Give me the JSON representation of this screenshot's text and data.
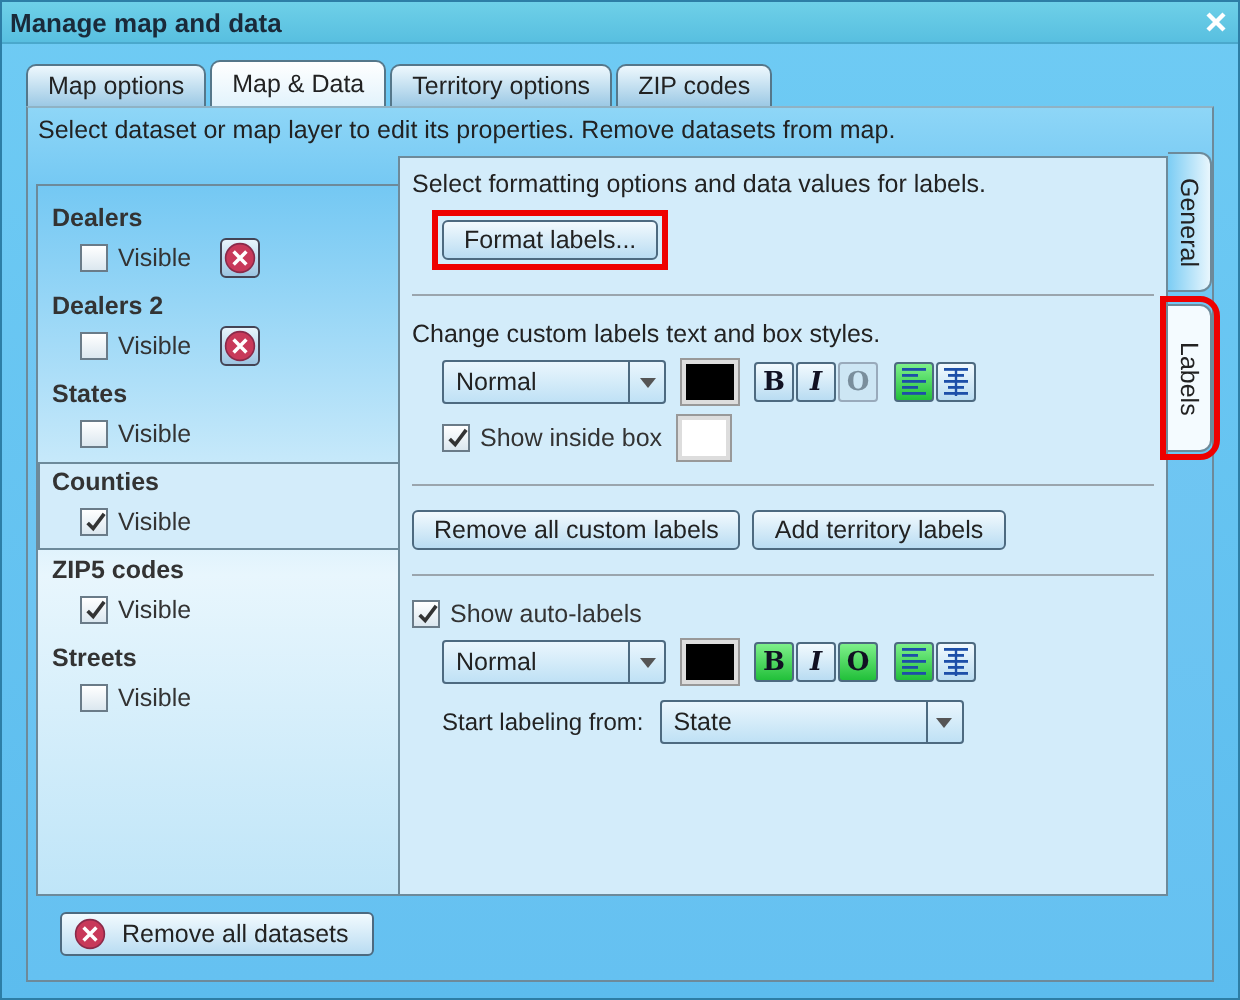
{
  "window": {
    "title": "Manage map and data"
  },
  "tabs": [
    {
      "label": "Map options",
      "selected": false
    },
    {
      "label": "Map & Data",
      "selected": true
    },
    {
      "label": "Territory options",
      "selected": false
    },
    {
      "label": "ZIP codes",
      "selected": false
    }
  ],
  "instructions": "Select dataset or map layer to edit its properties. Remove datasets from map.",
  "layers": [
    {
      "name": "Dealers",
      "checkbox": "Visible",
      "visible": false,
      "removable": true,
      "selected": false
    },
    {
      "name": "Dealers 2",
      "checkbox": "Visible",
      "visible": false,
      "removable": true,
      "selected": false
    },
    {
      "name": "States",
      "checkbox": "Visible",
      "visible": false,
      "removable": false,
      "selected": false
    },
    {
      "name": "Counties",
      "checkbox": "Visible",
      "visible": true,
      "removable": false,
      "selected": true
    },
    {
      "name": "ZIP5 codes",
      "checkbox": "Visible",
      "visible": true,
      "removable": false,
      "selected": false
    },
    {
      "name": "Streets",
      "checkbox": "Visible",
      "visible": false,
      "removable": false,
      "selected": false
    }
  ],
  "side_tabs": [
    {
      "label": "General",
      "selected": false,
      "highlighted": false
    },
    {
      "label": "Labels",
      "selected": true,
      "highlighted": true
    }
  ],
  "format_section": {
    "text": "Select formatting options and data values for labels.",
    "button": "Format labels...",
    "highlighted": true
  },
  "custom_section": {
    "text": "Change custom labels text and box styles.",
    "style": "Normal",
    "color": "#000000",
    "toggles": [
      {
        "label": "B",
        "kind": "bold",
        "on": false,
        "disabled": false
      },
      {
        "label": "I",
        "kind": "italic",
        "on": false,
        "disabled": false
      },
      {
        "label": "O",
        "kind": "outline",
        "on": false,
        "disabled": true
      }
    ],
    "align": [
      {
        "kind": "left",
        "on": true
      },
      {
        "kind": "center",
        "on": false
      }
    ],
    "box": {
      "label": "Show inside box",
      "checked": true,
      "color": "#ffffff"
    }
  },
  "label_buttons": [
    "Remove all custom labels",
    "Add territory labels"
  ],
  "auto_section": {
    "label": "Show auto-labels",
    "checked": true,
    "style": "Normal",
    "color": "#000000",
    "toggles": [
      {
        "label": "B",
        "kind": "bold",
        "on": true,
        "disabled": false
      },
      {
        "label": "I",
        "kind": "italic",
        "on": false,
        "disabled": false
      },
      {
        "label": "O",
        "kind": "outline",
        "on": true,
        "disabled": false
      }
    ],
    "align": [
      {
        "kind": "left",
        "on": true
      },
      {
        "kind": "center",
        "on": false
      }
    ],
    "start_label": "Start labeling from:",
    "start_value": "State"
  },
  "bottom_button": "Remove all datasets"
}
